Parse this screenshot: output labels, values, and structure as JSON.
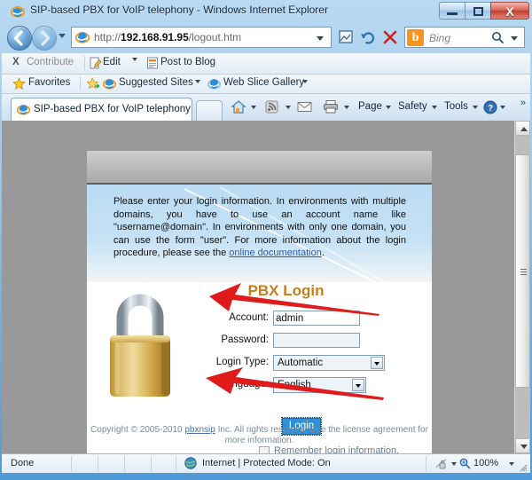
{
  "window": {
    "title": "SIP-based PBX for VoIP telephony - Windows Internet Explorer",
    "icon": "ie-icon",
    "minimize_label": "Minimize",
    "maximize_label": "Maximize",
    "close_label": "X"
  },
  "navigation": {
    "back_label": "Back",
    "forward_label": "Forward",
    "recent_pages_label": "Recent Pages",
    "address": {
      "protocol": "http://",
      "host": "192.168.91.95",
      "path": "/logout.htm",
      "full": "http://192.168.91.95/logout.htm"
    },
    "compatibility_label": "Compatibility View",
    "refresh_label": "Refresh",
    "stop_label": "Stop",
    "search": {
      "provider": "Bing",
      "logo": "b",
      "placeholder": "Bing"
    }
  },
  "contribute_bar": {
    "close_label": "X",
    "contribute_label": "Contribute",
    "edit_label": "Edit",
    "post_to_blog_label": "Post to Blog"
  },
  "favorites_bar": {
    "favorites_label": "Favorites",
    "suggested_sites_label": "Suggested Sites",
    "web_slice_gallery_label": "Web Slice Gallery"
  },
  "tabs": {
    "items": [
      {
        "label": "SIP-based PBX for VoIP telephony",
        "icon": "ie-icon",
        "active": true
      }
    ],
    "new_tab_label": ""
  },
  "command_bar": {
    "home_label": "Home",
    "feeds_label": "Feeds",
    "read_mail_label": "Read Mail",
    "print_label": "Print",
    "page_label": "Page",
    "safety_label": "Safety",
    "tools_label": "Tools",
    "help_label": "Help",
    "overflow_label": "»"
  },
  "page": {
    "intro_before_link": "Please enter your login information. In environments with multiple domains, you have to use an account name like \"username@domain\". In environments with only one domain, you can use the form \"user\". For more information about the login procedure, please see the ",
    "intro_link": "online documentation",
    "intro_after_link": ".",
    "heading": "PBX Login",
    "padlock_alt": "padlock-image",
    "form": {
      "account": {
        "label": "Account:",
        "value": "admin",
        "placeholder": ""
      },
      "password": {
        "label": "Password:",
        "value": "",
        "placeholder": ""
      },
      "login_type": {
        "label": "Login Type:",
        "value": "Automatic",
        "options": [
          "Automatic"
        ]
      },
      "language": {
        "label": "Language:",
        "value": "English",
        "options": [
          "English"
        ]
      },
      "login_button": "Login",
      "remember_label": "Remember login information.",
      "remember_checked": false
    },
    "footer": {
      "before_link": "Copyright © 2005-2010 ",
      "link": "pbxnsip",
      "after_link": " Inc. All rights reserved. See the license agreement for more information."
    }
  },
  "annotations": {
    "arrow_account_label": "arrow pointing to Account field",
    "arrow_login_label": "arrow pointing to Login button",
    "arrow_color": "#e01b1b"
  },
  "scrollbar": {
    "up_label": "Scroll up",
    "down_label": "Scroll down",
    "thumb_label": "Scroll thumb"
  },
  "status_bar": {
    "status": "Done",
    "zone": "Internet | Protected Mode: On",
    "zone_icon": "globe-icon",
    "zoom": "100%",
    "privacy_icon": "privacy-icon"
  }
}
